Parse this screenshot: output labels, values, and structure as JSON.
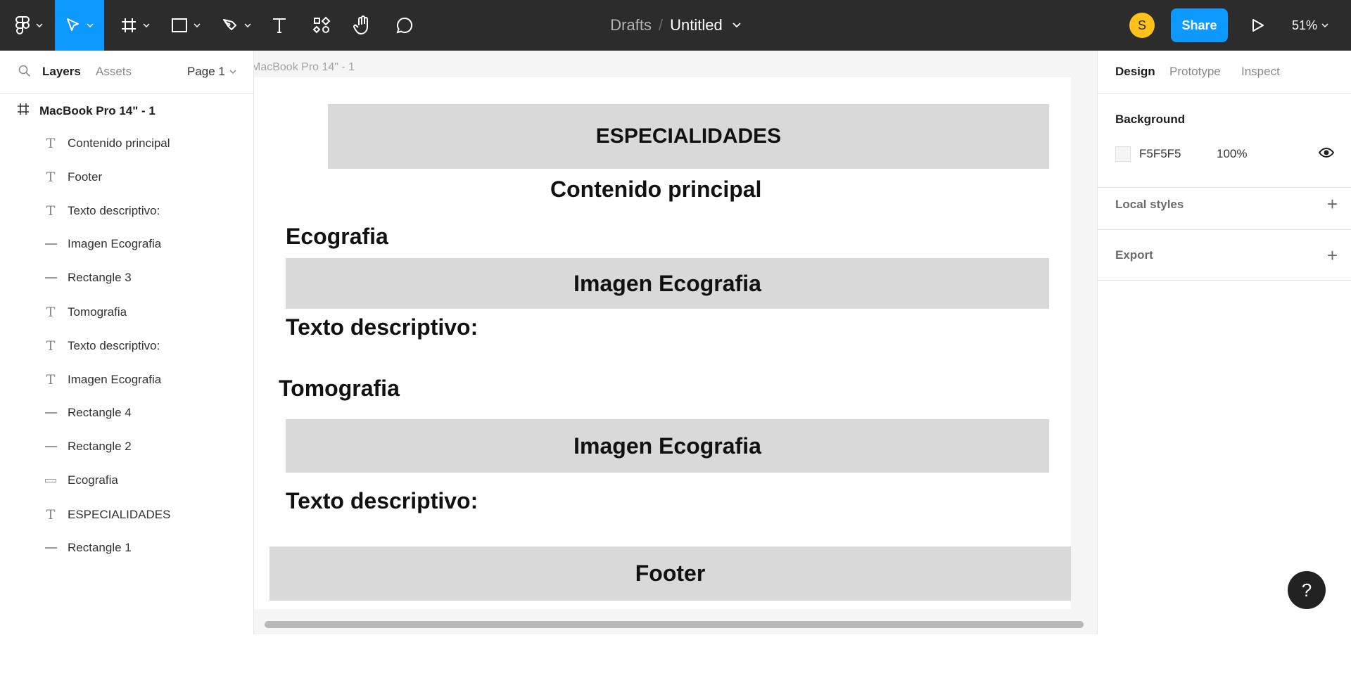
{
  "toolbar": {
    "icons": [
      "figma-menu-icon",
      "move-tool-icon",
      "frame-tool-icon",
      "rectangle-tool-icon",
      "pen-tool-icon",
      "text-tool-icon",
      "resources-icon",
      "hand-tool-icon",
      "comment-icon",
      "play-icon"
    ],
    "breadcrumb_root": "Drafts",
    "breadcrumb_sep": "/",
    "file_title": "Untitled",
    "avatar_initial": "S",
    "share_label": "Share",
    "zoom": "51%",
    "accent": "#0d99ff",
    "bg": "#2c2c2c",
    "avatar_color": "#ffc21a"
  },
  "left_panel": {
    "tabs": [
      "Layers",
      "Assets"
    ],
    "page_label": "Page 1",
    "root_layer": "MacBook Pro 14\" - 1",
    "layers": [
      {
        "label": "Contenido principal",
        "icon": "text-layer-icon"
      },
      {
        "label": "Footer",
        "icon": "text-layer-icon"
      },
      {
        "label": "Texto descriptivo:",
        "icon": "text-layer-icon"
      },
      {
        "label": "Imagen Ecografia",
        "icon": "line-layer-icon"
      },
      {
        "label": "Rectangle 3",
        "icon": "line-layer-icon"
      },
      {
        "label": "Tomografia",
        "icon": "text-layer-icon"
      },
      {
        "label": "Texto descriptivo:",
        "icon": "text-layer-icon"
      },
      {
        "label": "Imagen Ecografia",
        "icon": "text-layer-icon"
      },
      {
        "label": "Rectangle 4",
        "icon": "line-layer-icon"
      },
      {
        "label": "Rectangle 2",
        "icon": "line-layer-icon"
      },
      {
        "label": "Ecografia",
        "icon": "rectangle-layer-icon"
      },
      {
        "label": "ESPECIALIDADES",
        "icon": "text-layer-icon"
      },
      {
        "label": "Rectangle 1",
        "icon": "line-layer-icon"
      }
    ]
  },
  "canvas": {
    "frame_label": "MacBook Pro 14\" - 1",
    "background": "#f5f5f5",
    "box_color": "#d9d9d9",
    "header": "ESPECIALIDADES",
    "main_title": "Contenido principal",
    "section1_title": "Ecografia",
    "image1": "Imagen Ecografia",
    "desc1": "Texto descriptivo:",
    "section2_title": "Tomografia",
    "image2": "Imagen Ecografia",
    "desc2": "Texto descriptivo:",
    "footer": "Footer"
  },
  "right_panel": {
    "tabs": [
      "Design",
      "Prototype",
      "Inspect"
    ],
    "background_title": "Background",
    "bg_hex": "F5F5F5",
    "bg_opacity": "100%",
    "local_styles": "Local styles",
    "export": "Export",
    "help": "?"
  }
}
